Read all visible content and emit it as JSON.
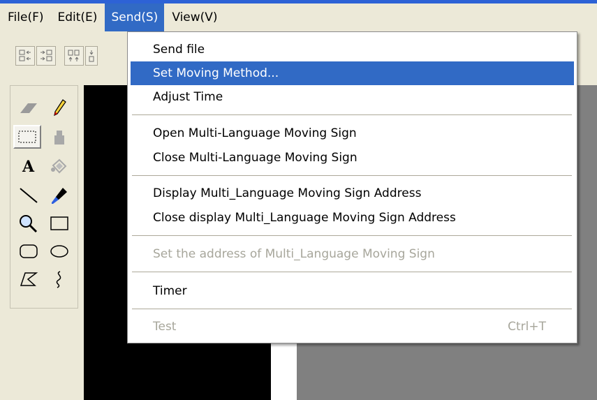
{
  "menubar": {
    "items": [
      {
        "label": "File(F)"
      },
      {
        "label": "Edit(E)"
      },
      {
        "label": "Send(S)"
      },
      {
        "label": "View(V)"
      }
    ]
  },
  "send_menu": {
    "items": [
      {
        "label": "Send file"
      },
      {
        "label": "Set Moving Method..."
      },
      {
        "label": "Adjust Time"
      },
      {
        "label": "Open Multi-Language Moving Sign"
      },
      {
        "label": "Close Multi-Language Moving Sign"
      },
      {
        "label": "Display Multi_Language Moving Sign Address"
      },
      {
        "label": "Close display Multi_Language Moving Sign Address"
      },
      {
        "label": "Set the address of Multi_Language Moving Sign"
      },
      {
        "label": "Timer"
      },
      {
        "label": "Test",
        "shortcut": "Ctrl+T"
      }
    ]
  },
  "toolbox": {
    "tools": [
      "eraser-icon",
      "pencil-icon",
      "rect-select-icon",
      "airbrush-icon",
      "text-icon",
      "fill-icon",
      "line-icon",
      "color-picker-icon",
      "magnifier-icon",
      "rectangle-icon",
      "rounded-rect-icon",
      "ellipse-icon",
      "polygon-icon",
      "curve-icon"
    ]
  },
  "colors": {
    "accent": "#316ac5",
    "menubar": "#ece9d8",
    "canvas": "#000000",
    "workspace": "#808080"
  }
}
